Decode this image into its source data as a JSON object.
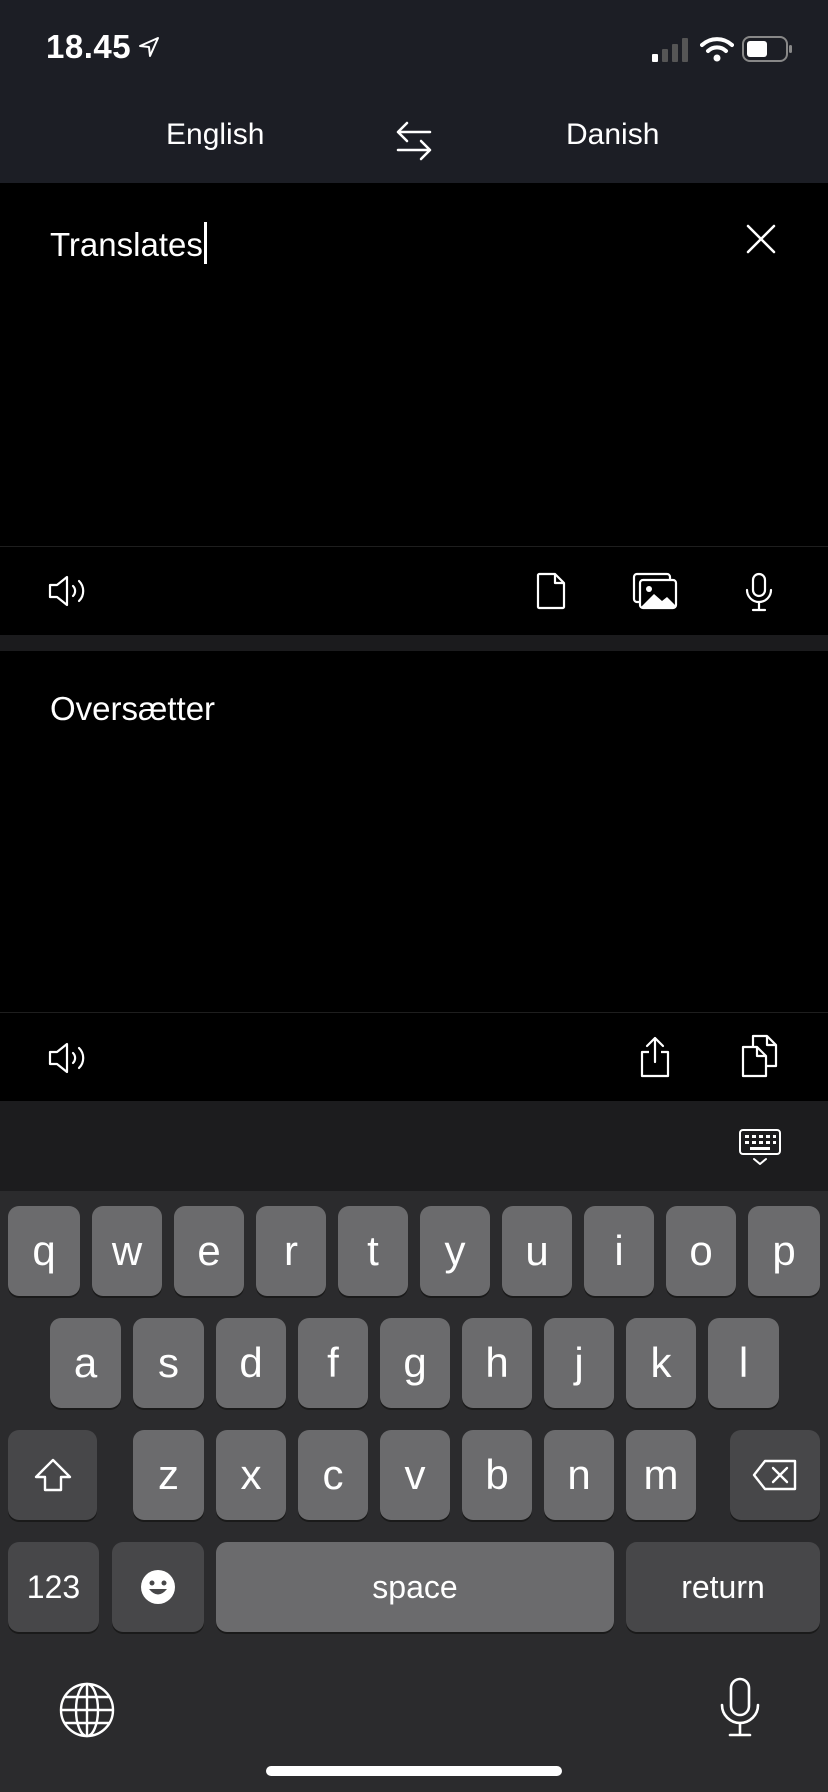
{
  "status_bar": {
    "time": "18.45"
  },
  "header": {
    "source_language": "English",
    "target_language": "Danish"
  },
  "input": {
    "text": "Translates"
  },
  "output": {
    "text": "Oversætter"
  },
  "icons": {
    "location": "location-arrow-icon",
    "swap": "swap-languages-icon",
    "clear": "close-icon",
    "speaker": "speaker-icon",
    "document": "document-icon",
    "image": "image-icon",
    "microphone": "microphone-icon",
    "share": "share-icon",
    "copy": "copy-icon",
    "keyboard_dismiss": "keyboard-dismiss-icon",
    "globe": "globe-icon",
    "dictation": "dictation-icon"
  },
  "keyboard": {
    "row1": [
      "q",
      "w",
      "e",
      "r",
      "t",
      "y",
      "u",
      "i",
      "o",
      "p"
    ],
    "row2": [
      "a",
      "s",
      "d",
      "f",
      "g",
      "h",
      "j",
      "k",
      "l"
    ],
    "row3": [
      "z",
      "x",
      "c",
      "v",
      "b",
      "n",
      "m"
    ],
    "numbers_label": "123",
    "space_label": "space",
    "return_label": "return"
  },
  "colors": {
    "header_bg": "#1c1e25",
    "key_bg": "#6b6b6d",
    "special_key_bg": "#474749",
    "keyboard_bg": "#2b2b2d"
  }
}
